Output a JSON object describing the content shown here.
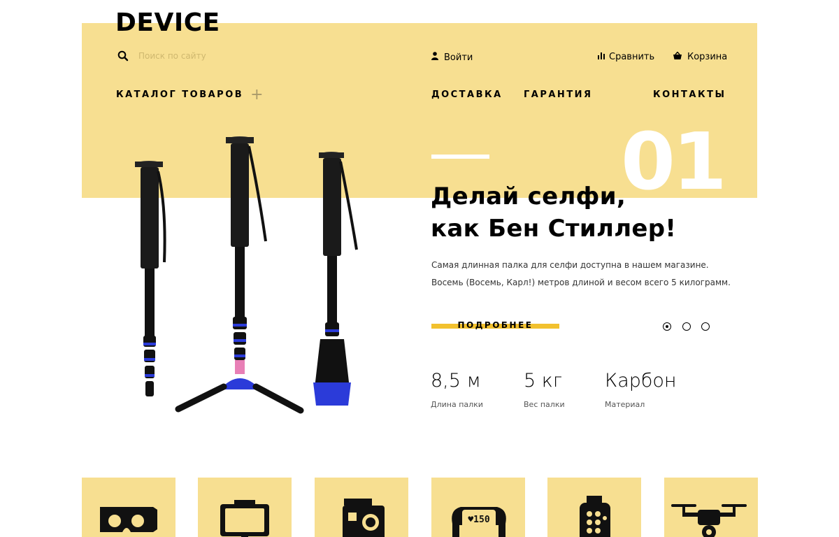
{
  "header": {
    "logo": "DEVICE",
    "search": {
      "placeholder": "Поиск по сайту",
      "icon": "search-icon"
    },
    "login_label": "Войти",
    "compare_label": "Сравнить",
    "cart_label": "Корзина"
  },
  "nav": {
    "catalog_label": "КАТАЛОГ ТОВАРОВ",
    "items": [
      {
        "label": "ДОСТАВКА"
      },
      {
        "label": "ГАРАНТИЯ"
      },
      {
        "label": "КОНТАКТЫ"
      }
    ]
  },
  "slider": {
    "slide_number": "01",
    "title_line1": "Делай селфи,",
    "title_line2": "как Бен Стиллер!",
    "description_line1": "Самая длинная палка для селфи доступна в нашем магазине.",
    "description_line2": "Восемь (Восемь, Карл!) метров длиной и весом всего 5 килограмм.",
    "more_label": "ПОДРОБНЕЕ",
    "active_dot": 1,
    "dots": 3
  },
  "stats": [
    {
      "value": "8,5 м",
      "label": "Длина палки"
    },
    {
      "value": "5 кг",
      "label": "Вес палки"
    },
    {
      "value": "Карбон",
      "label": "Материал"
    }
  ],
  "categories": [
    {
      "icon": "vr-headset-icon"
    },
    {
      "icon": "phone-holder-icon"
    },
    {
      "icon": "action-camera-icon"
    },
    {
      "icon": "fitness-band-icon"
    },
    {
      "icon": "smartwatch-icon"
    },
    {
      "icon": "drone-icon"
    }
  ],
  "band_display_text": "♥150",
  "colors": {
    "accent_yellow": "#f7df91",
    "button_yellow": "#f2c12e",
    "text": "#000000"
  }
}
